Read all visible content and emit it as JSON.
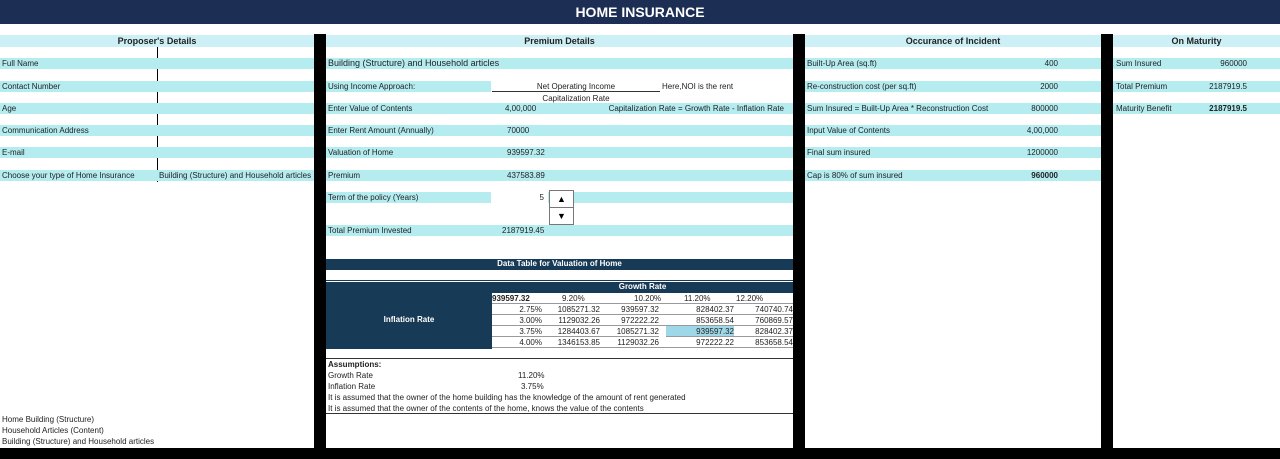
{
  "title": "HOME INSURANCE",
  "headers": {
    "proposer": "Proposer's Details",
    "premium": "Premium Details",
    "occurance": "Occurance of Incident",
    "maturity": "On Maturity"
  },
  "proposer": {
    "labels": [
      "Full Name",
      "Contact Number",
      "Age",
      "Communication Address",
      "E-mail",
      "Choose your type of Home Insurance"
    ],
    "insurance_type_value": "Building (Structure) and Household articles",
    "type_options": [
      "Home Building (Structure)",
      "Household Articles (Content)",
      "Building (Structure) and Household articles"
    ]
  },
  "premium": {
    "row1_label": "Building (Structure) and Household articles",
    "income_label": "Using Income Approach:",
    "noi_label": "Net Operating Income",
    "cap_label": "Capitalization Rate",
    "noi_note": "Here,NOI is the rent",
    "contents_label": "Enter Value of Contents",
    "contents_value": "4,00,000",
    "cap_formula": "Capitalization Rate = Growth Rate - Inflation Rate",
    "rent_label": "Enter Rent Amount (Annually)",
    "rent_value": "70000",
    "valuation_label": "Valuation of Home",
    "valuation_value": "939597.32",
    "premium_label": "Premium",
    "premium_value": "437583.89",
    "term_label": "Term of the policy (Years)",
    "term_value": "5",
    "total_label": "Total Premium Invested",
    "total_value": "2187919.45"
  },
  "spinner": {
    "up": "▲",
    "down": "▼"
  },
  "data_table": {
    "title": "Data Table for Valuation of Home",
    "growth_label": "Growth Rate",
    "inflation_label": "Inflation Rate",
    "corner": "939597.32",
    "growth_rates": [
      "9.20%",
      "10.20%",
      "11.20%",
      "12.20%"
    ],
    "rows": [
      {
        "rate": "2.75%",
        "values": [
          "1085271.32",
          "939597.32",
          "828402.37",
          "740740.74"
        ]
      },
      {
        "rate": "3.00%",
        "values": [
          "1129032.26",
          "972222.22",
          "853658.54",
          "760869.57"
        ]
      },
      {
        "rate": "3.75%",
        "values": [
          "1284403.67",
          "1085271.32",
          "939597.32",
          "828402.37"
        ]
      },
      {
        "rate": "4.00%",
        "values": [
          "1346153.85",
          "1129032.26",
          "972222.22",
          "853658.54"
        ]
      }
    ]
  },
  "assumptions": {
    "title": "Assumptions:",
    "growth_label": "Growth Rate",
    "growth_value": "11.20%",
    "inflation_label": "Inflation Rate",
    "inflation_value": "3.75%",
    "note1": "It is assumed that the owner of the home building has the knowledge of the amount of rent generated",
    "note2": "It is assumed that the owner of the contents of the home, knows the value of the contents"
  },
  "occurance": {
    "rows": [
      {
        "label": "Built-Up Area (sq.ft)",
        "value": "400"
      },
      {
        "label": "Re-construction cost (per sq.ft)",
        "value": "2000"
      },
      {
        "label": "Sum Insured = Built-Up Area * Reconstruction Cost",
        "value": "800000"
      },
      {
        "label": "Input Value of Contents",
        "value": "4,00,000"
      },
      {
        "label": "Final sum insured",
        "value": "1200000"
      },
      {
        "label": "Cap is 80% of sum insured",
        "value": "960000"
      }
    ]
  },
  "maturity": {
    "rows": [
      {
        "label": "Sum Insured",
        "value": "960000"
      },
      {
        "label": "Total Premium",
        "value": "2187919.5"
      },
      {
        "label": "Maturity Benefit",
        "value": "2187919.5"
      }
    ]
  }
}
